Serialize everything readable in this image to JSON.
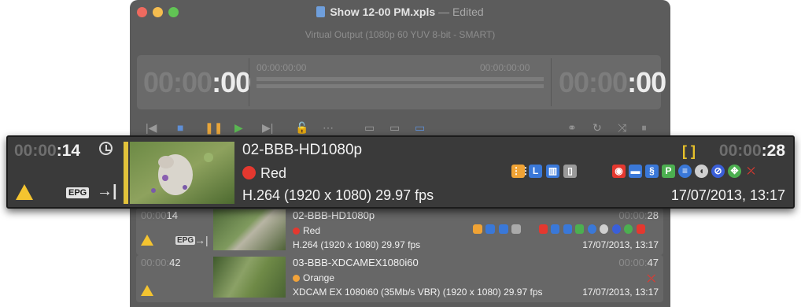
{
  "window": {
    "title": "Show 12-00 PM.xpls",
    "edited": "Edited",
    "title_separator": "—",
    "subtitle": "Virtual Output (1080p 60 YUV 8-bit - SMART)"
  },
  "timecode_panel": {
    "left_dim": "00:00",
    "left_lit": ":00",
    "left_label": "00:00:00:00",
    "right_label": "00:00:00:00",
    "right_dim": "00:00",
    "right_lit": ":00"
  },
  "toolbar": {
    "icons": [
      "skip-back-icon",
      "stop-icon",
      "pause-icon",
      "play-icon",
      "skip-forward-icon",
      "unlock-icon",
      "more-icon",
      "view-small-icon",
      "view-medium-icon",
      "view-large-icon",
      "link-icon",
      "loop-icon",
      "shuffle-icon",
      "pause-box-icon"
    ]
  },
  "highlight": {
    "elapsed_dim": "00:00",
    "elapsed_lit": ":14",
    "name": "02-BBB-HD1080p",
    "color_label": "Red",
    "color_hex": "#e4382f",
    "format": "H.264 (1920 x 1080) 29.97 fps",
    "duration_dim": "00:00",
    "duration_lit": ":28",
    "date": "17/07/2013, 13:17",
    "epg": "EPG",
    "badge_L": "L",
    "badge_P": "P"
  },
  "rows": [
    {
      "elapsed_dim": "00:00",
      "elapsed_lit": "14",
      "name": "02-BBB-HD1080p",
      "color_label": "Red",
      "color_hex": "#e4382f",
      "format": "H.264 (1920 x 1080) 29.97 fps",
      "duration_dim": "00:00:",
      "duration_lit": "28",
      "date": "17/07/2013, 13:17",
      "epg": "EPG"
    },
    {
      "elapsed_dim": "00:00:",
      "elapsed_lit": "42",
      "name": "03-BBB-XDCAMEX1080i60",
      "color_label": "Orange",
      "color_hex": "#f2a33a",
      "format": "XDCAM EX 1080i60 (35Mb/s VBR) (1920 x 1080) 29.97 fps",
      "duration_dim": "00:00:",
      "duration_lit": "47",
      "date": "17/07/2013, 13:17"
    }
  ]
}
